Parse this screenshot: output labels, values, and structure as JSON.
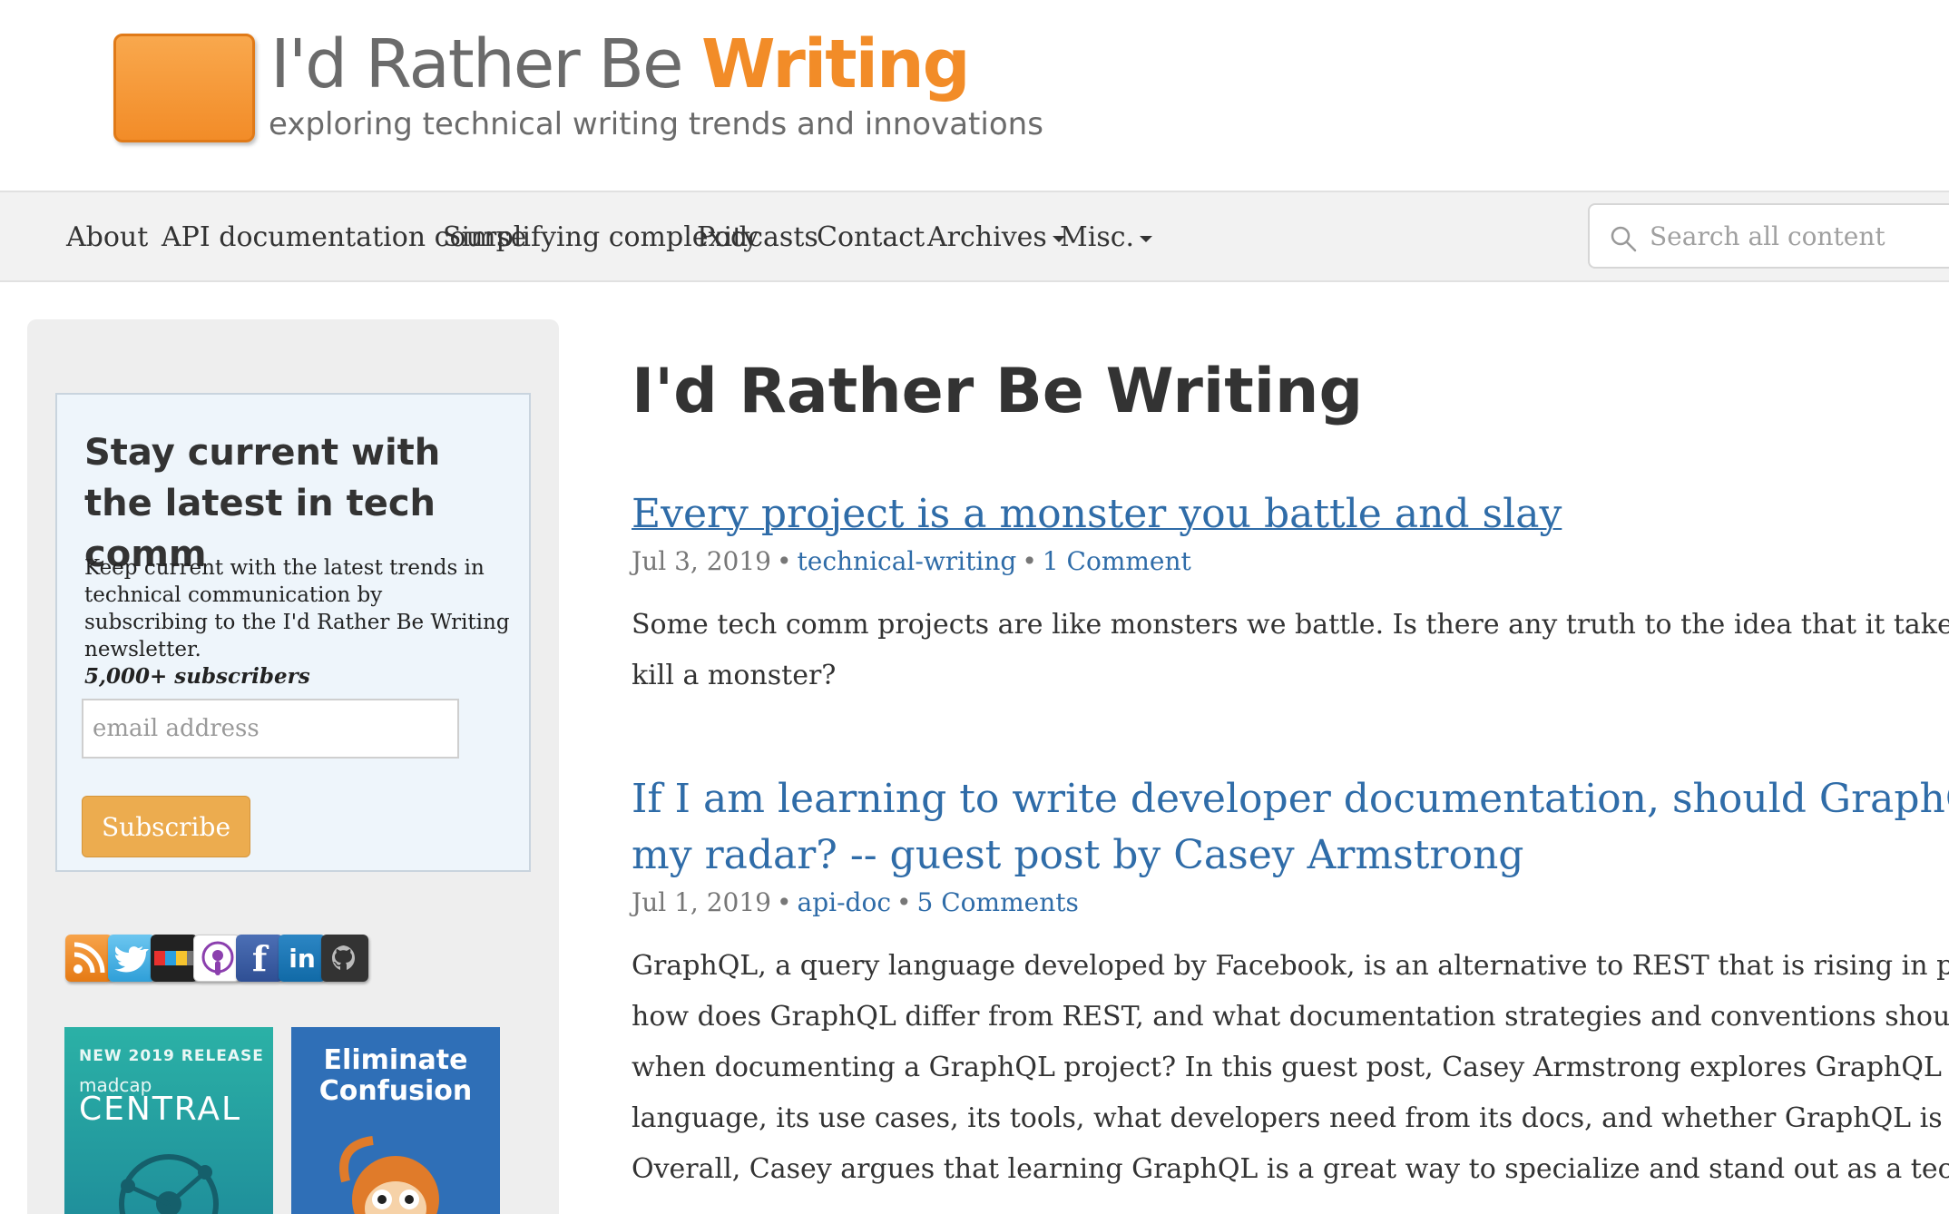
{
  "site": {
    "title_plain": "I'd Rather Be ",
    "title_accent": "Writing",
    "tagline": "exploring technical writing trends and innovations"
  },
  "nav": {
    "items": [
      "About",
      "API documentation course",
      "Simplifying complexity",
      "Podcasts",
      "Contact",
      "Archives",
      "Misc."
    ],
    "search_placeholder": "Search all content"
  },
  "sidebar": {
    "newsletter": {
      "heading": "Stay current with the latest in tech comm",
      "body": "Keep current with the latest trends in technical communication by subscribing to the I'd Rather Be Writing newsletter.",
      "subscribers": "5,000+ subscribers",
      "email_placeholder": "email address",
      "button": "Subscribe"
    },
    "social_icons": [
      "rss-icon",
      "twitter-icon",
      "flickr-icon",
      "podcast-icon",
      "facebook-icon",
      "linkedin-icon",
      "github-icon"
    ],
    "ads": {
      "madcap": {
        "release": "NEW 2019 RELEASE",
        "brand": "madcap",
        "product": "CENTRAL"
      },
      "eliminate": {
        "text": "Eliminate Confusion"
      }
    }
  },
  "main": {
    "page_title": "I'd Rather Be Writing",
    "posts": [
      {
        "title": "Every project is a monster you battle and slay",
        "date": "Jul 3, 2019",
        "category": "technical-writing",
        "comments": "1 Comment",
        "excerpt": [
          "Some tech comm projects are like monsters we battle. Is there any truth to the idea that it takes a m",
          "kill a monster?"
        ]
      },
      {
        "title_lines": [
          "If I am learning to write developer documentation, should GraphQL",
          "my radar? -- guest post by Casey Armstrong"
        ],
        "date": "Jul 1, 2019",
        "category": "api-doc",
        "comments": "5 Comments",
        "excerpt": [
          "GraphQL, a query language developed by Facebook, is an alternative to REST that is rising in popul",
          "how does GraphQL differ from REST, and what documentation strategies and conventions should y",
          "when documenting a GraphQL project? In this guest post, Casey Armstrong explores GraphQL — th",
          "language, its use cases, its tools, what developers need from its docs, and whether GraphQL is wort",
          "Overall, Casey argues that learning GraphQL is a great way to specialize and stand out as a technica"
        ]
      }
    ]
  },
  "colors": {
    "accent": "#f28c28",
    "link": "#2f6ca8",
    "button": "#ecac4f"
  }
}
